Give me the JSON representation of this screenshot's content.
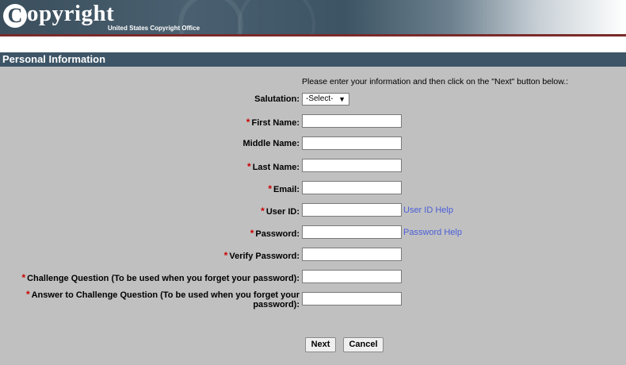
{
  "header": {
    "logo_letter": "C",
    "logo_word": "opyright",
    "logo_subtitle": "United States Copyright Office"
  },
  "section": {
    "title": "Personal Information"
  },
  "form": {
    "instructions": "Please enter your information and then click on the \"Next\" button below.:",
    "salutation": {
      "label": "Salutation:",
      "selected": "-Select-"
    },
    "fields": [
      {
        "label": "First Name:",
        "required": true,
        "value": ""
      },
      {
        "label": "Middle Name:",
        "required": false,
        "value": ""
      },
      {
        "label": "Last Name:",
        "required": true,
        "value": ""
      },
      {
        "label": "Email:",
        "required": true,
        "value": ""
      },
      {
        "label": "User ID:",
        "required": true,
        "value": "",
        "help": "User ID Help"
      },
      {
        "label": "Password:",
        "required": true,
        "value": "",
        "help": "Password Help"
      },
      {
        "label": "Verify Password:",
        "required": true,
        "value": ""
      },
      {
        "label": "Challenge Question (To be used when you forget your password):",
        "required": true,
        "value": ""
      },
      {
        "label_line1": "Answer to Challenge Question (To be used when you forget your",
        "label_line2": "password):",
        "required": true,
        "value": ""
      }
    ],
    "required_marker": "*",
    "dropdown_arrow": "▼"
  },
  "buttons": {
    "next": "Next",
    "cancel": "Cancel"
  },
  "colors": {
    "header_bar": "#3d5566",
    "form_bg": "#c0c0c0",
    "required": "#cc0000",
    "link": "#4a5ed8"
  }
}
